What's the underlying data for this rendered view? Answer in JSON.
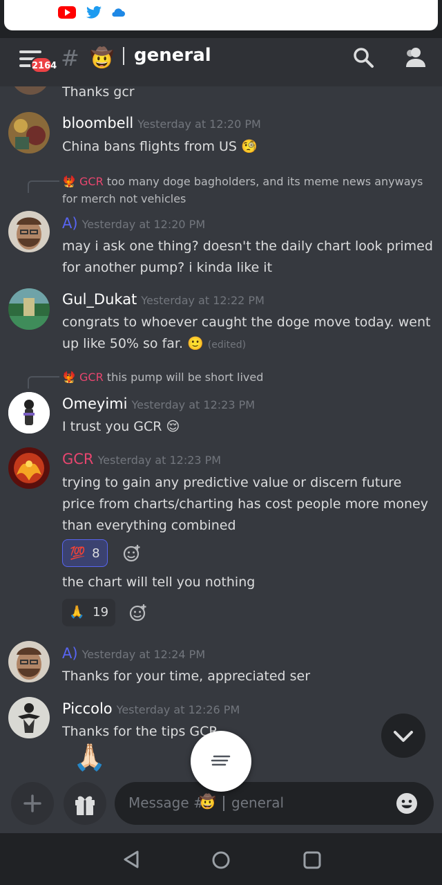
{
  "status_icons": [
    "youtube-icon",
    "twitter-icon",
    "cloud-icon"
  ],
  "header": {
    "badge_count": "2164",
    "hash": "#",
    "channel_emoji": "🤠",
    "channel_name": "general"
  },
  "messages": [
    {
      "author": "",
      "text": "Thanks gcr"
    },
    {
      "author": "bloombell",
      "time": "Yesterday at 12:20 PM",
      "text": "China bans flights from US 🧐"
    },
    {
      "reply_name": "GCR",
      "reply_text": "too many doge bagholders, and its meme news anyways for merch not vehicles"
    },
    {
      "author": "A)",
      "time": "Yesterday at 12:20 PM",
      "text": "may i ask one thing? doesn't the daily chart look primed for another pump? i kinda like it"
    },
    {
      "author": "Gul_Dukat",
      "time": "Yesterday at 12:22 PM",
      "text": "congrats to whoever caught the doge move today. went up like 50% so far. 🙂",
      "edited": "(edited)"
    },
    {
      "reply_name": "GCR",
      "reply_text": "this pump will be short lived"
    },
    {
      "author": "Omeyimi",
      "time": "Yesterday at 12:23 PM",
      "text": "I trust you GCR 😌"
    },
    {
      "author": "GCR",
      "time": "Yesterday at 12:23 PM",
      "text": "trying to gain any predictive value or discern future price from charts/charting has cost people more money than everything combined",
      "reaction_emoji": "💯",
      "reaction_count": "8",
      "text2": "the chart will tell you nothing",
      "reaction2_emoji": "🙏",
      "reaction2_count": "19"
    },
    {
      "author": "A)",
      "time": "Yesterday at 12:24 PM",
      "text": "Thanks for your time, appreciated ser"
    },
    {
      "author": "Piccolo",
      "time": "Yesterday at 12:26 PM",
      "text": "Thanks for the tips GCR",
      "emoji_line": "🙏🏻"
    }
  ],
  "composer": {
    "placeholder_prefix": "Message #",
    "placeholder_emoji": "🤠",
    "placeholder_channel": "general"
  },
  "colors": {
    "background": "#36393f",
    "header": "#2f3136",
    "gcr_name": "#e8466f",
    "a_name": "#5865f2",
    "badge": "#ed4245"
  }
}
